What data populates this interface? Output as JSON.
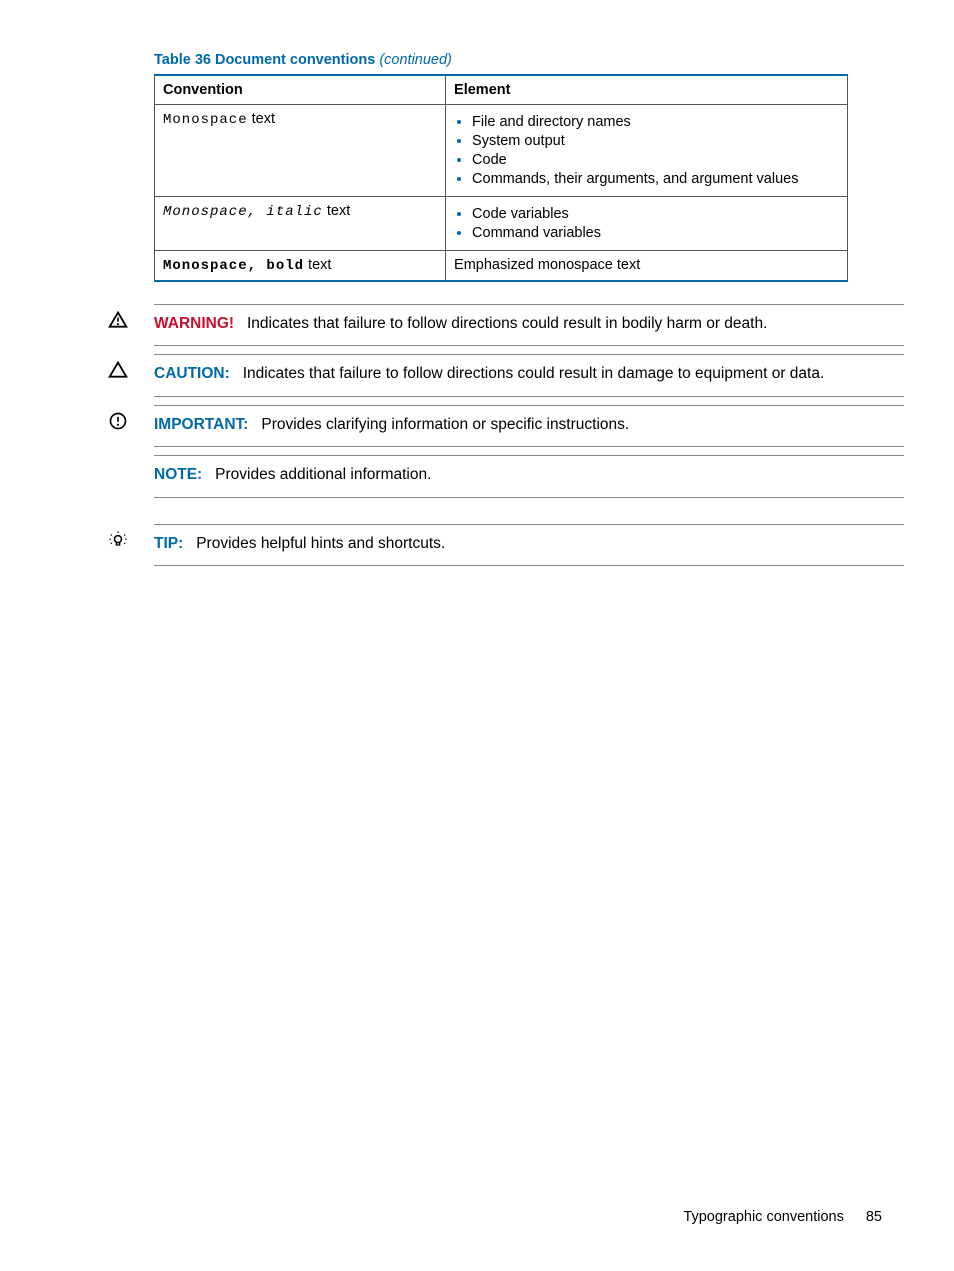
{
  "table": {
    "caption_prefix": "Table 36 Document conventions",
    "caption_suffix": "(continued)",
    "headers": {
      "col1": "Convention",
      "col2": "Element"
    },
    "rows": [
      {
        "conv_mono": "Monospace",
        "conv_rest": " text",
        "items": [
          "File and directory names",
          "System output",
          "Code",
          "Commands, their arguments, and argument values"
        ]
      },
      {
        "conv_mono": "Monospace, italic",
        "conv_rest": " text",
        "items": [
          "Code variables",
          "Command variables"
        ]
      },
      {
        "conv_mono": "Monospace, bold",
        "conv_rest": " text",
        "plain": "Emphasized monospace text"
      }
    ]
  },
  "admonitions": {
    "warning": {
      "label": "WARNING!",
      "text": "Indicates that failure to follow directions could result in bodily harm or death."
    },
    "caution": {
      "label": "CAUTION:",
      "text": "Indicates that failure to follow directions could result in damage to equipment or data."
    },
    "important": {
      "label": "IMPORTANT:",
      "text": "Provides clarifying information or specific instructions."
    },
    "note": {
      "label": "NOTE:",
      "text": "Provides additional information."
    },
    "tip": {
      "label": "TIP:",
      "text": "Provides helpful hints and shortcuts."
    }
  },
  "footer": {
    "section": "Typographic conventions",
    "page": "85"
  }
}
